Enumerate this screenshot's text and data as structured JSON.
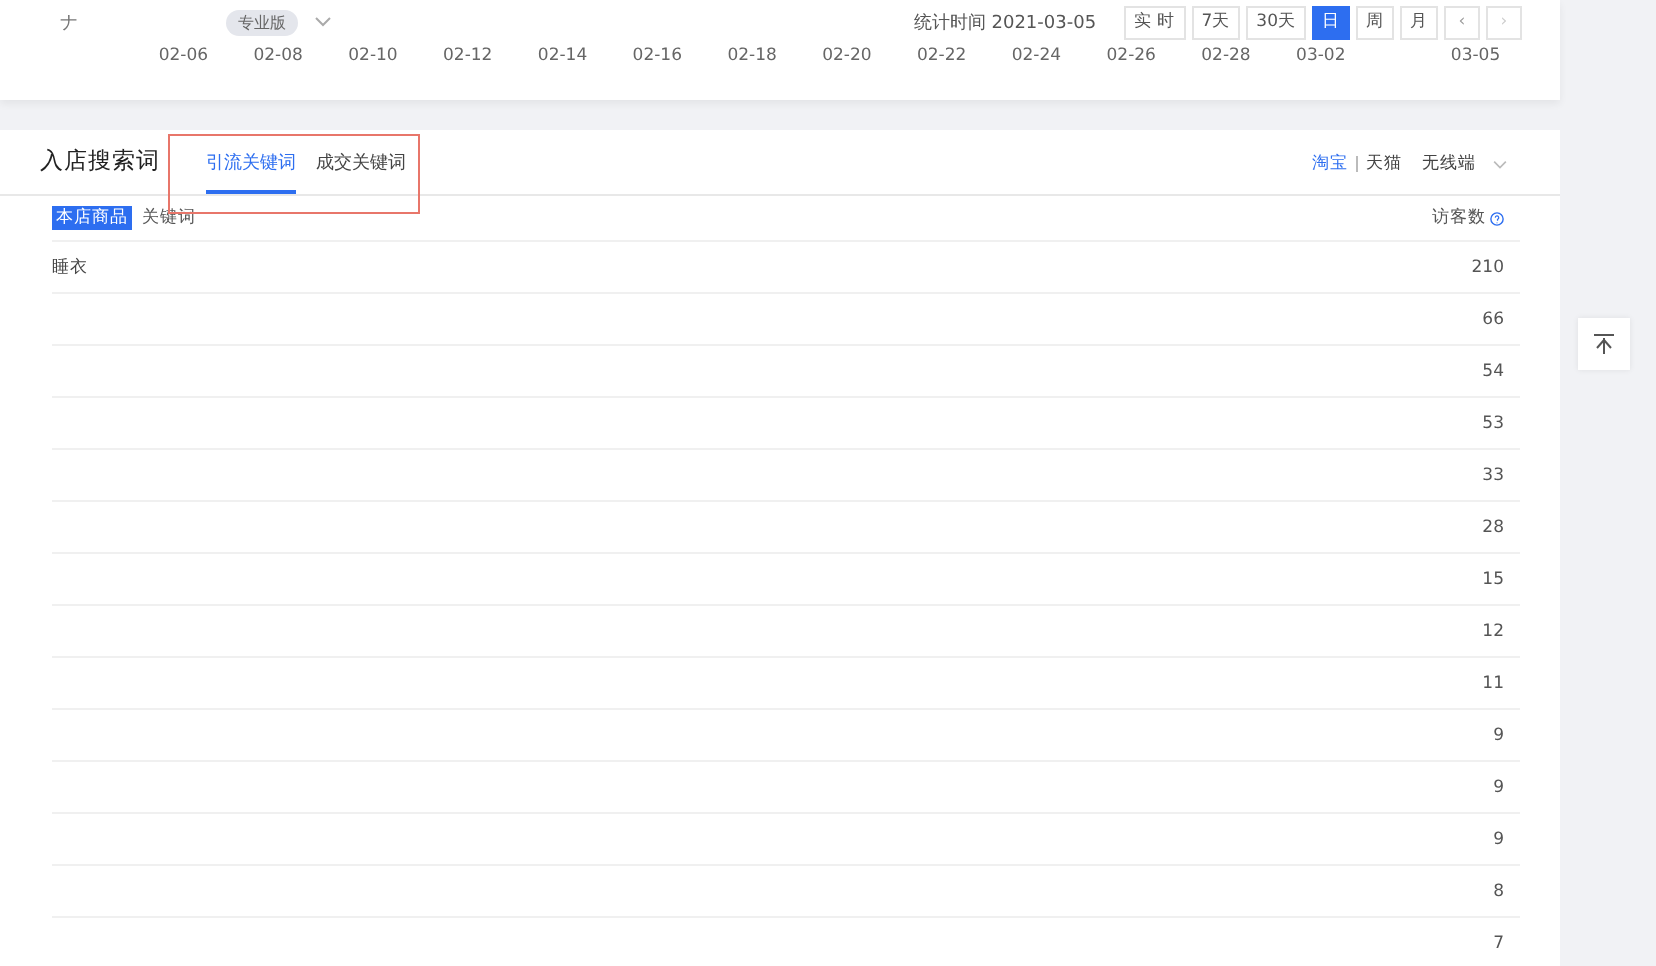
{
  "header": {
    "shop_name": "ナ",
    "edition_badge": "专业版",
    "stat_time": "统计时间 2021-03-05",
    "range_buttons": [
      {
        "label": "实 时",
        "selected": false
      },
      {
        "label": "7天",
        "selected": false
      },
      {
        "label": "30天",
        "selected": false
      },
      {
        "label": "日",
        "selected": true
      },
      {
        "label": "周",
        "selected": false
      },
      {
        "label": "月",
        "selected": false
      }
    ],
    "prev": "‹",
    "next": "›"
  },
  "axis_labels": [
    "02-06",
    "02-08",
    "02-10",
    "02-12",
    "02-14",
    "02-16",
    "02-18",
    "02-20",
    "02-22",
    "02-24",
    "02-26",
    "02-28",
    "03-02",
    "03-05"
  ],
  "panel": {
    "title": "入店搜索词",
    "tabs": [
      {
        "label": "引流关键词",
        "selected": true
      },
      {
        "label": "成交关键词",
        "selected": false
      }
    ],
    "platforms": [
      {
        "label": "淘宝",
        "selected": true
      },
      {
        "label": "天猫",
        "selected": false
      }
    ],
    "device": "无线端",
    "scope_badge": "本店商品",
    "keyword_heading": "关键词",
    "visitors_heading": "访客数",
    "rows": [
      {
        "keyword": "睡衣",
        "visitors": "210"
      },
      {
        "visitors": "66"
      },
      {
        "visitors": "54"
      },
      {
        "visitors": "53"
      },
      {
        "visitors": "33"
      },
      {
        "visitors": "28"
      },
      {
        "visitors": "15"
      },
      {
        "visitors": "12"
      },
      {
        "visitors": "11"
      },
      {
        "visitors": "9"
      },
      {
        "visitors": "9"
      },
      {
        "visitors": "9"
      },
      {
        "visitors": "8"
      },
      {
        "visitors": "7"
      }
    ]
  }
}
